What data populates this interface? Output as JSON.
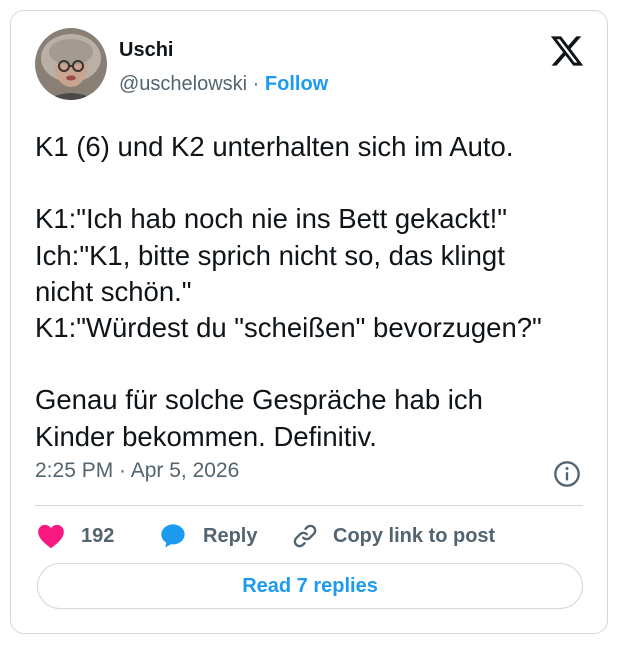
{
  "author": {
    "name": "Uschi",
    "handle": "@uschelowski",
    "separator": " · ",
    "follow_label": "Follow",
    "avatar_icon": "profile-photo"
  },
  "tweet": {
    "lines": [
      "K1 (6) und K2 unterhalten sich im Auto.",
      "",
      "K1:\"Ich hab noch nie ins Bett gekackt!\"",
      "Ich:\"K1, bitte sprich nicht so, das klingt",
      "nicht schön.\"",
      "K1:\"Würdest du \"scheißen\" bevorzugen?\"",
      "",
      "Genau für solche Gespräche hab ich",
      "Kinder bekommen. Definitiv."
    ],
    "timestamp": "2:25 PM · Apr 5, 2026"
  },
  "actions": {
    "like_count": "192",
    "reply_label": "Reply",
    "copy_label": "Copy link to post",
    "read_replies_label": "Read 7 replies"
  },
  "colors": {
    "accent": "#1d9bf0",
    "heart": "#f91880",
    "text": "#0f1419",
    "secondary": "#536471",
    "border": "#cfd9de"
  },
  "icons": [
    "x-logo-icon",
    "info-icon",
    "heart-icon",
    "reply-bubble-icon",
    "link-icon"
  ]
}
